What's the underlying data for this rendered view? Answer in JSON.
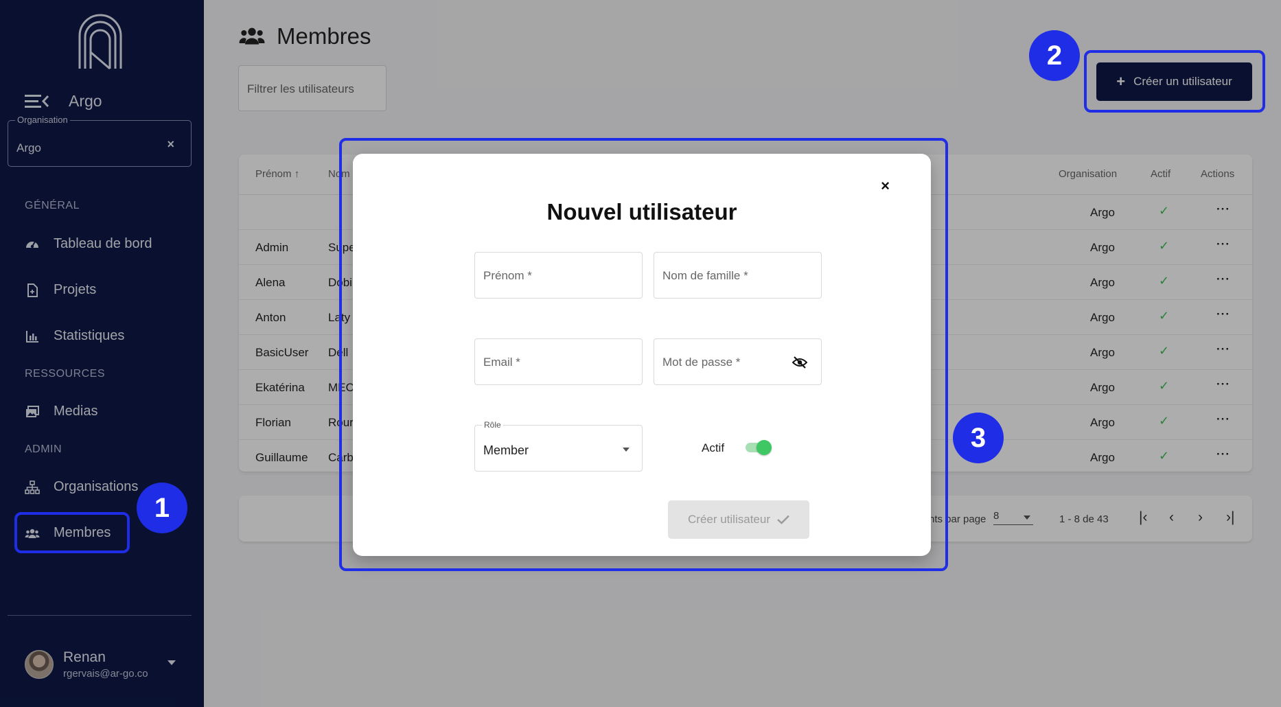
{
  "sidebar": {
    "brand": "Argo",
    "org_field": {
      "label": "Organisation",
      "value": "Argo",
      "clear": "×"
    },
    "sections": {
      "general": "GÉNÉRAL",
      "ressources": "RESSOURCES",
      "admin": "ADMIN"
    },
    "items": [
      {
        "label": "Tableau de bord",
        "icon": "dashboard-icon"
      },
      {
        "label": "Projets",
        "icon": "document-icon"
      },
      {
        "label": "Statistiques",
        "icon": "bar-chart-icon"
      },
      {
        "label": "Medias",
        "icon": "images-icon"
      },
      {
        "label": "Organisations",
        "icon": "org-chart-icon"
      },
      {
        "label": "Membres",
        "icon": "users-icon"
      }
    ],
    "user": {
      "name": "Renan",
      "email": "rgervais@ar-go.co"
    }
  },
  "page": {
    "title": "Membres",
    "filter_placeholder": "Filtrer les utilisateurs",
    "create_button": "Créer un utilisateur"
  },
  "table": {
    "headers": {
      "first": "Prénom ↑",
      "last": "Nom",
      "org": "Organisation",
      "active": "Actif",
      "actions": "Actions"
    },
    "rows": [
      {
        "first": "",
        "last": "",
        "org": "Argo"
      },
      {
        "first": "Admin",
        "last": "Supe",
        "org": "Argo"
      },
      {
        "first": "Alena",
        "last": "Dobi",
        "org": "Argo"
      },
      {
        "first": "Anton",
        "last": "Laty",
        "org": "Argo"
      },
      {
        "first": "BasicUser",
        "last": "Dell",
        "org": "Argo"
      },
      {
        "first": "Ekatérina",
        "last": "MEC",
        "org": "Argo"
      },
      {
        "first": "Florian",
        "last": "Rour",
        "org": "Argo"
      },
      {
        "first": "Guillaume",
        "last": "Carb",
        "org": "Argo"
      }
    ],
    "check": "✓",
    "dots": "···"
  },
  "pager": {
    "per_page_label": "nts par page",
    "per_page_value": "8",
    "range": "1 - 8 de 43",
    "first": "|‹",
    "prev": "‹",
    "next": "›",
    "last": "›|"
  },
  "modal": {
    "title": "Nouvel utilisateur",
    "close": "×",
    "first_name_placeholder": "Prénom *",
    "last_name_placeholder": "Nom de famille *",
    "email_placeholder": "Email *",
    "password_placeholder": "Mot de passe *",
    "role_label": "Rôle",
    "role_value": "Member",
    "active_label": "Actif",
    "active_on": true,
    "submit": "Créer utilisateur"
  },
  "annotations": {
    "one": "1",
    "two": "2",
    "three": "3"
  },
  "colors": {
    "sidebar": "#0f1a48",
    "accent": "#1f2de6",
    "success": "#3fbf57"
  }
}
